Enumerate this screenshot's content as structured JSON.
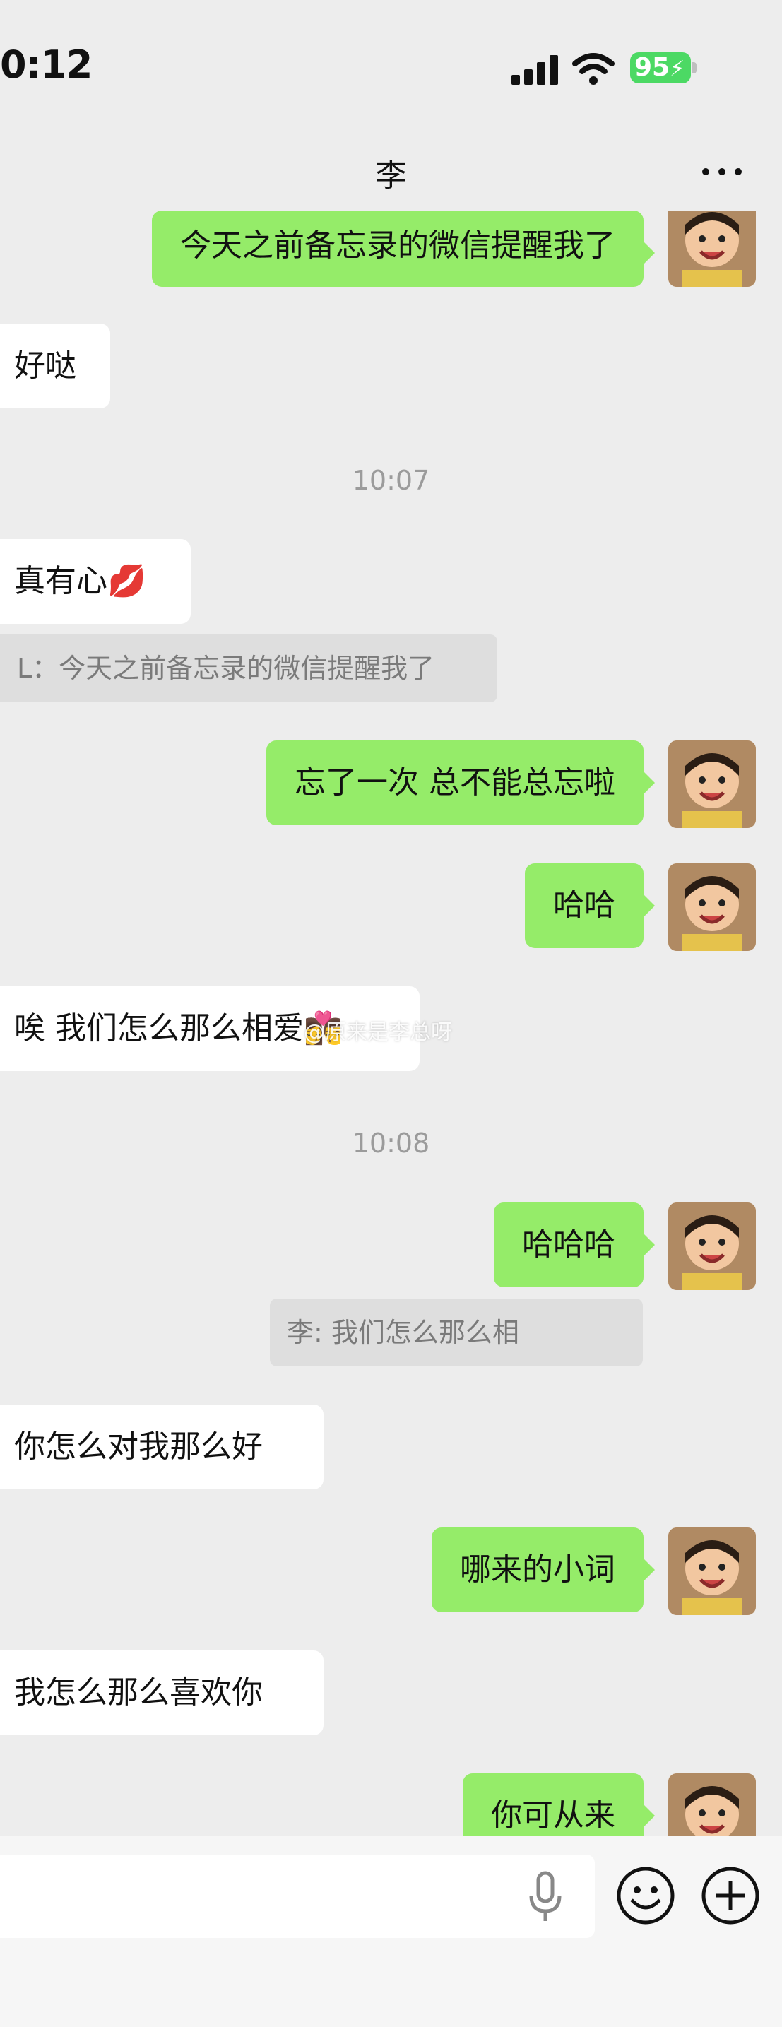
{
  "status_bar": {
    "time": "0:12",
    "battery": "95"
  },
  "header": {
    "title": "李"
  },
  "messages": {
    "m1": "今天之前备忘录的微信提醒我了",
    "m2": "好哒",
    "t1": "10:07",
    "m3": "真有心💋",
    "q1": "L：今天之前备忘录的微信提醒我了",
    "m4": "忘了一次 总不能总忘啦",
    "m5": "哈哈",
    "m6": "唉 我们怎么那么相爱👩‍❤️‍💋‍👨",
    "watermark": "@原来是李总呀",
    "t2": "10:08",
    "m7": "哈哈哈",
    "q2": "李: 我们怎么那么相",
    "m8": "你怎么对我那么好",
    "m9": "哪来的小词",
    "m10": "我怎么那么喜欢你",
    "m11": "你可从来"
  },
  "icons": {
    "more": "more-dots-icon",
    "mic": "microphone-icon",
    "emoji": "emoji-icon",
    "plus": "plus-icon"
  },
  "colors": {
    "my_bubble": "#95ec69",
    "their_bubble": "#ffffff",
    "background": "#ededed",
    "battery": "#4cd964"
  }
}
